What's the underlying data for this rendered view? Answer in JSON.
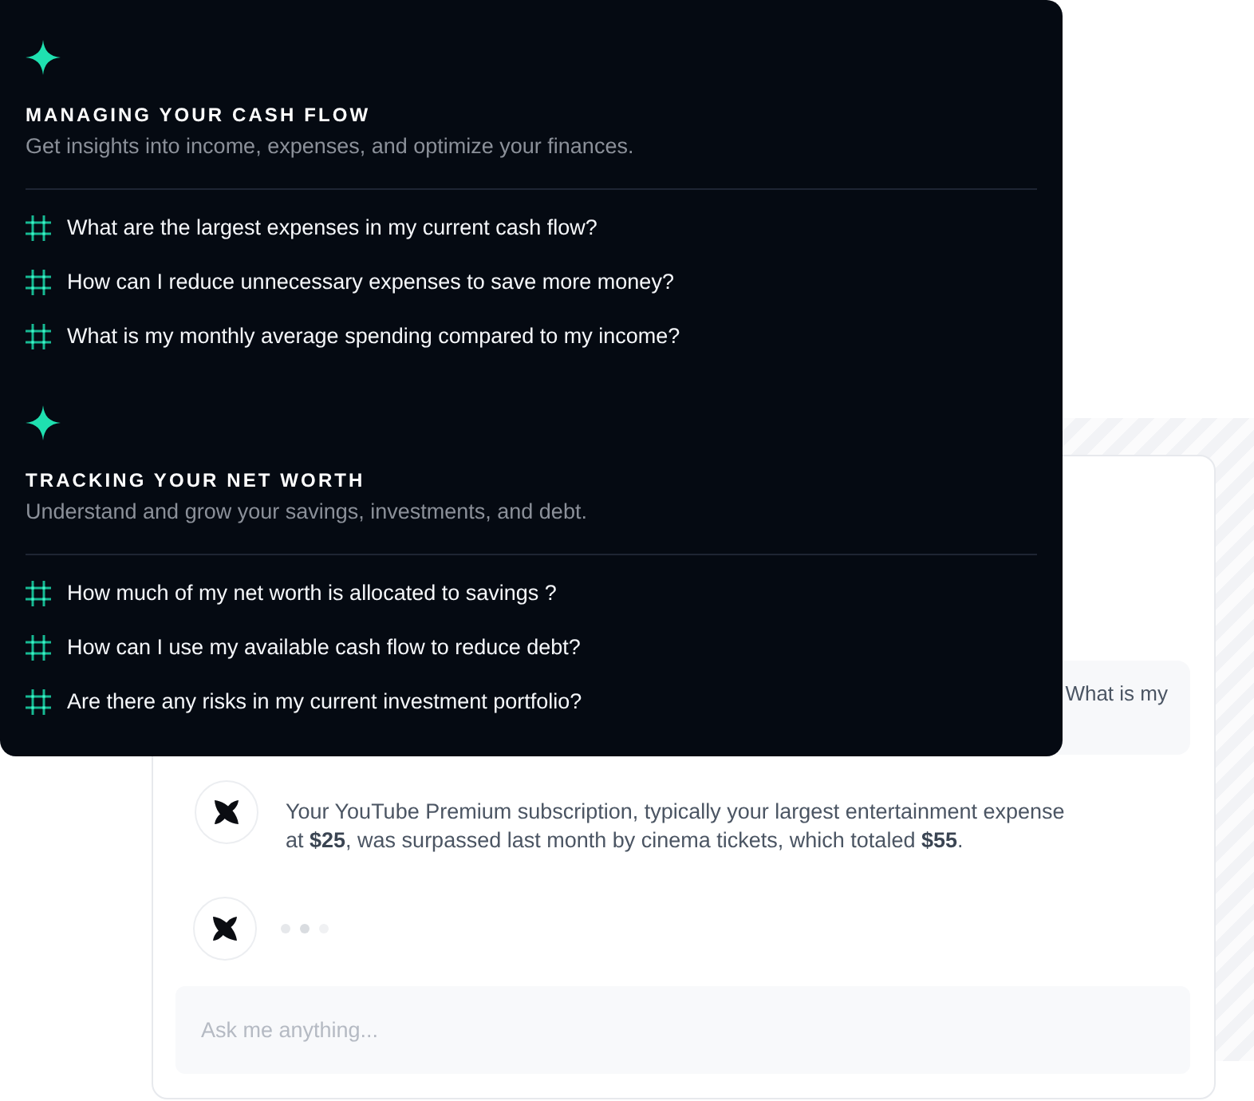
{
  "sections": [
    {
      "title": "MANAGING YOUR CASH FLOW",
      "subtitle": "Get insights into income, expenses, and optimize your finances.",
      "questions": [
        "What are the largest expenses in my current cash flow?",
        "How can I reduce unnecessary expenses to save more money?",
        "What is my monthly average spending compared to my income?"
      ]
    },
    {
      "title": "TRACKING YOUR NET WORTH",
      "subtitle": "Understand and grow your savings, investments, and debt.",
      "questions": [
        "How much of my net worth is allocated to savings ?",
        "How can I use my available cash flow to reduce debt?",
        "Are there any risks in my current investment portfolio?"
      ]
    }
  ],
  "chat": {
    "messages": [
      {
        "kind": "user",
        "text": "What is my"
      },
      {
        "kind": "assistant",
        "text": "Your YouTube Premium subscription, typically your largest entertainment expense at **$25**, was surpassed last month by cinema tickets, which totaled **$55**."
      },
      {
        "kind": "typing"
      }
    ],
    "input": {
      "placeholder": "Ask me anything..."
    }
  }
}
